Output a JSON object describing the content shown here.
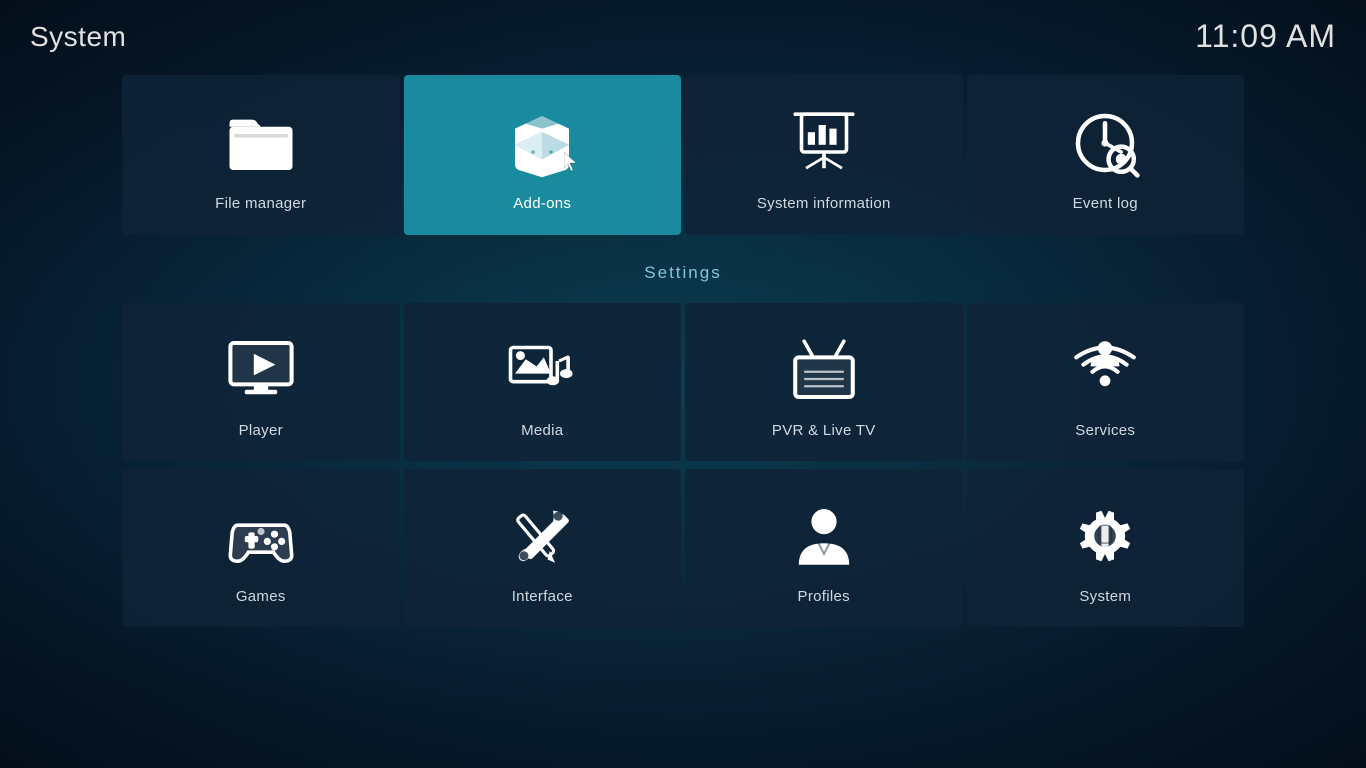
{
  "header": {
    "title": "System",
    "time": "11:09 AM"
  },
  "top_row": [
    {
      "id": "file-manager",
      "label": "File manager",
      "icon": "folder"
    },
    {
      "id": "add-ons",
      "label": "Add-ons",
      "icon": "addons",
      "active": true
    },
    {
      "id": "system-information",
      "label": "System information",
      "icon": "sysinfo"
    },
    {
      "id": "event-log",
      "label": "Event log",
      "icon": "eventlog"
    }
  ],
  "settings_label": "Settings",
  "settings_rows": [
    [
      {
        "id": "player",
        "label": "Player",
        "icon": "player"
      },
      {
        "id": "media",
        "label": "Media",
        "icon": "media"
      },
      {
        "id": "pvr-live-tv",
        "label": "PVR & Live TV",
        "icon": "pvr"
      },
      {
        "id": "services",
        "label": "Services",
        "icon": "services"
      }
    ],
    [
      {
        "id": "games",
        "label": "Games",
        "icon": "games"
      },
      {
        "id": "interface",
        "label": "Interface",
        "icon": "interface"
      },
      {
        "id": "profiles",
        "label": "Profiles",
        "icon": "profiles"
      },
      {
        "id": "system",
        "label": "System",
        "icon": "system"
      }
    ]
  ]
}
